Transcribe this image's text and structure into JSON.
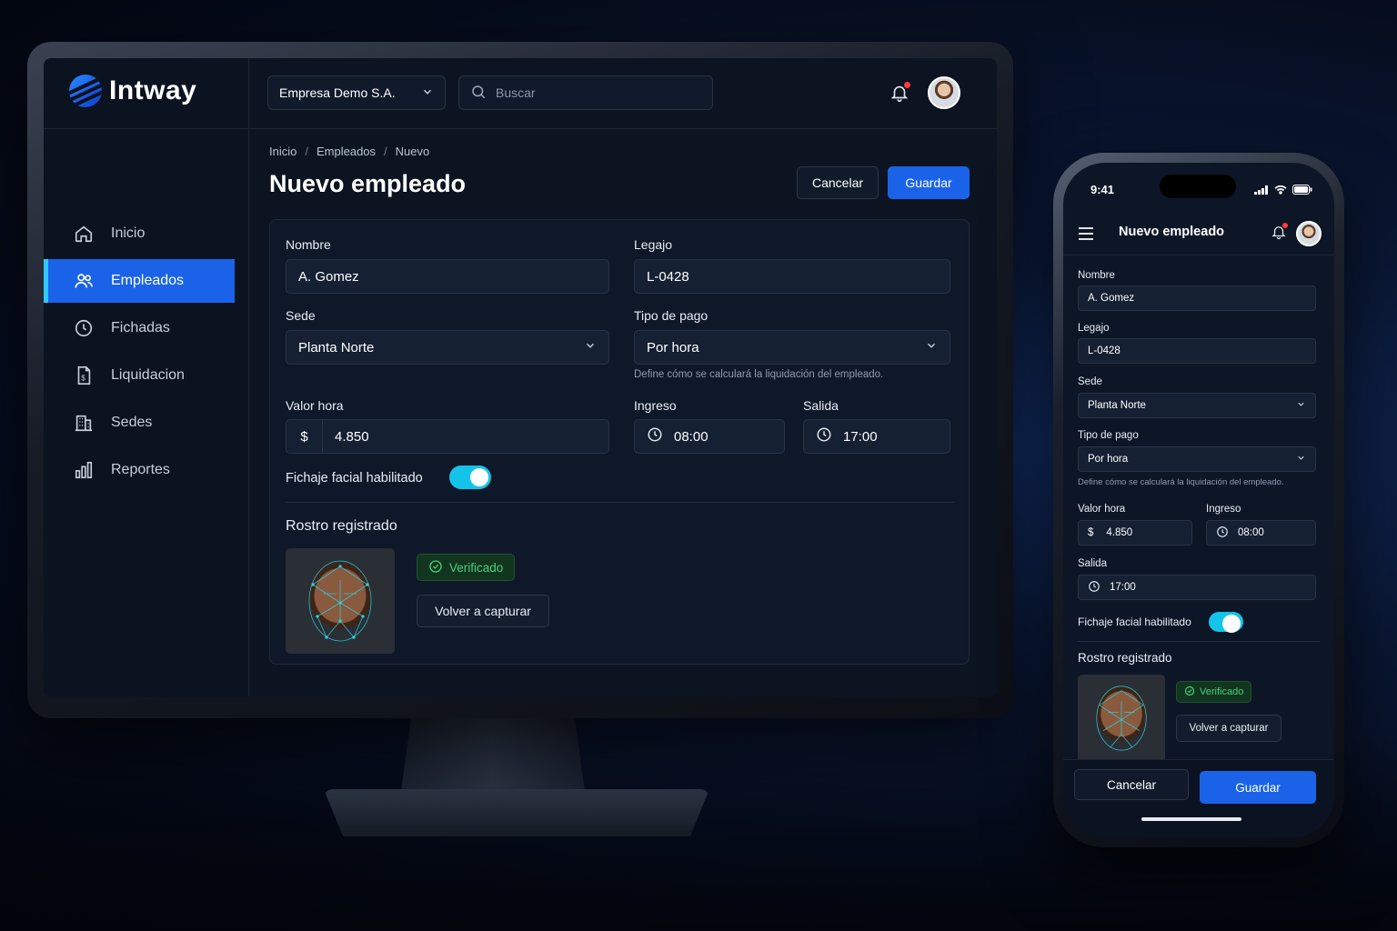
{
  "desktop": {
    "brand": "Intway",
    "company": "Empresa Demo S.A.",
    "search_placeholder": "Buscar",
    "nav": [
      {
        "label": "Inicio",
        "icon": "home-icon"
      },
      {
        "label": "Empleados",
        "icon": "users-icon",
        "active": true
      },
      {
        "label": "Fichadas",
        "icon": "clock-icon"
      },
      {
        "label": "Liquidacion",
        "icon": "document-dollar-icon"
      },
      {
        "label": "Sedes",
        "icon": "building-icon"
      },
      {
        "label": "Reportes",
        "icon": "bar-chart-icon"
      }
    ],
    "breadcrumb": [
      "Inicio",
      "Empleados",
      "Nuevo"
    ],
    "breadcrumb_sep": "/",
    "title": "Nuevo empleado",
    "cancel": "Cancelar",
    "save": "Guardar"
  },
  "form": {
    "nombre_label": "Nombre",
    "nombre_value": "A. Gomez",
    "legajo_label": "Legajo",
    "legajo_value": "L-0428",
    "sede_label": "Sede",
    "sede_value": "Planta Norte",
    "tipo_pago_label": "Tipo de pago",
    "tipo_pago_value": "Por hora",
    "tipo_pago_hint": "Define cómo se calculará la liquidación del empleado.",
    "valor_hora_label": "Valor hora",
    "currency": "$",
    "valor_hora_value": "4.850",
    "ingreso_label": "Ingreso",
    "ingreso_value": "08:00",
    "salida_label": "Salida",
    "salida_value": "17:00",
    "facial_label": "Fichaje facial habilitado",
    "facial_enabled": true,
    "rostro_label": "Rostro registrado",
    "verified": "Verificado",
    "recapture": "Volver a capturar"
  },
  "phone": {
    "time": "9:41",
    "title": "Nuevo empleado",
    "cancel": "Cancelar",
    "save": "Guardar"
  },
  "colors": {
    "primary": "#1a63e8",
    "toggle": "#14c4e8",
    "verified": "#49d07a",
    "notification": "#ff3b3b"
  }
}
